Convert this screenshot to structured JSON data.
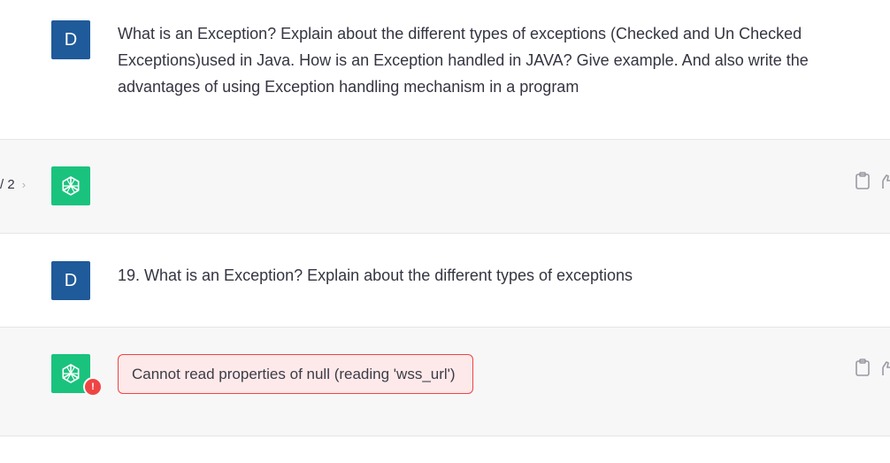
{
  "conversation": [
    {
      "role": "user",
      "avatar_letter": "D",
      "text": "What is an Exception? Explain about the different types of exceptions (Checked and Un Checked Exceptions)used in Java. How is an Exception handled in JAVA? Give example. And also write the advantages of using Exception handling mechanism in a program"
    },
    {
      "role": "assistant",
      "pager": {
        "current": "/ 2",
        "next_icon": "chevron-right-icon"
      },
      "text": ""
    },
    {
      "role": "user",
      "avatar_letter": "D",
      "text": "19.  What is an Exception? Explain about the different types of exceptions"
    },
    {
      "role": "assistant",
      "error_text": "Cannot read properties of null (reading 'wss_url')",
      "error_badge": "!"
    }
  ],
  "icons": {
    "copy": "clipboard-icon",
    "feedback": "thumbs-up-icon",
    "assistant_logo": "openai-logo-icon"
  },
  "colors": {
    "user_avatar": "#1f5a9a",
    "assistant_avatar": "#19c37d",
    "error_border": "#ef4444",
    "error_bg": "#fde9ea",
    "assistant_row_bg": "#f7f7f8"
  }
}
